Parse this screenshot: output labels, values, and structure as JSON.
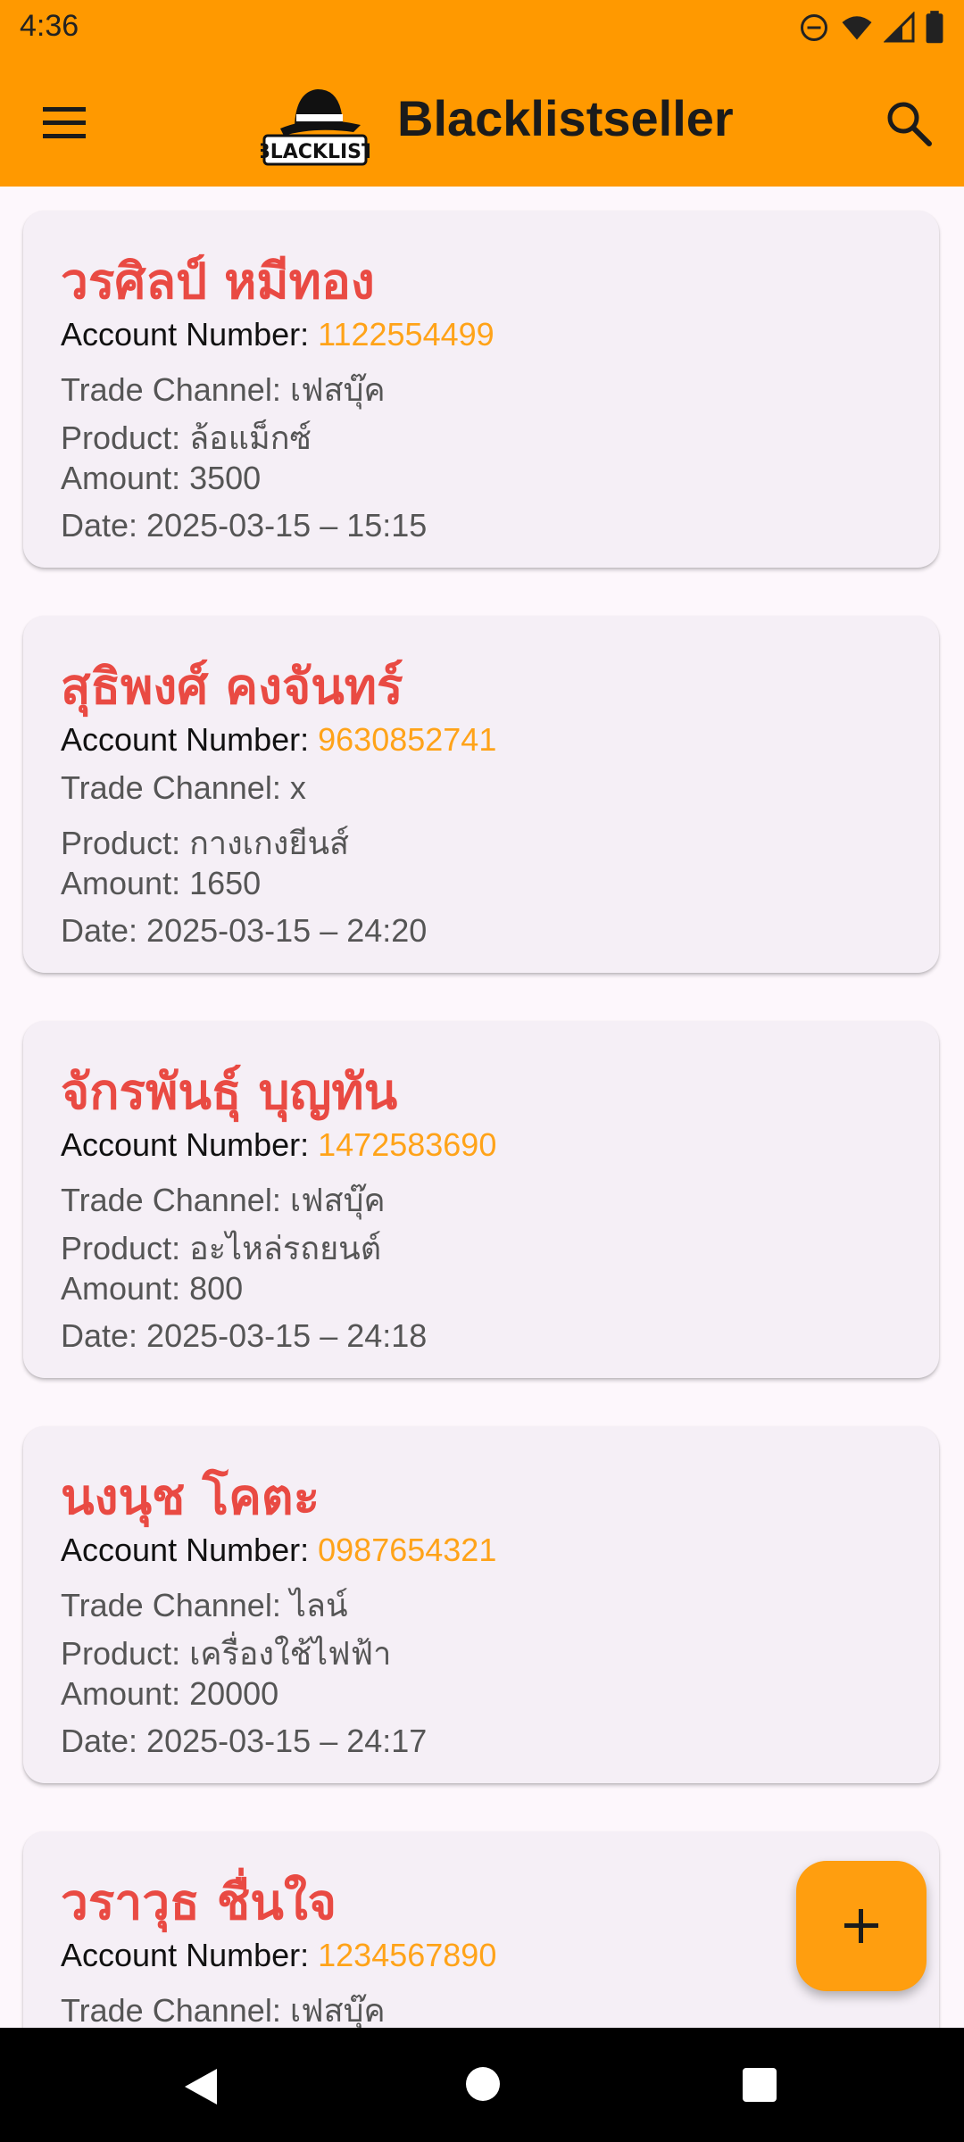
{
  "status_bar": {
    "time": "4:36",
    "icons": [
      "do-not-disturb-icon",
      "wifi-icon",
      "signal-icon",
      "battery-icon"
    ]
  },
  "app_bar": {
    "logo_text": "BLACKLIST",
    "title": "Blacklistseller",
    "menu_icon": "menu-icon",
    "search_icon": "search-icon",
    "color": "#ff9900"
  },
  "labels": {
    "account": "Account Number: ",
    "channel": "Trade Channel: ",
    "product": "Product: ",
    "amount": "Amount: ",
    "date": "Date: "
  },
  "records": [
    {
      "name": "วรศิลป์ หมีทอง",
      "account": "1122554499",
      "channel": "เฟสบุ๊ค",
      "product": "ล้อแม็กซ์",
      "amount": "3500",
      "date": "2025-03-15 – 15:15"
    },
    {
      "name": "สุธิพงศ์ คงจันทร์",
      "account": "9630852741",
      "channel": "x",
      "product": "กางเกงยีนส์",
      "amount": "1650",
      "date": "2025-03-15 – 24:20"
    },
    {
      "name": "จักรพันธุ์ บุญทัน",
      "account": "1472583690",
      "channel": "เฟสบุ๊ค",
      "product": "อะไหล่รถยนต์",
      "amount": "800",
      "date": "2025-03-15 – 24:18"
    },
    {
      "name": "นงนุช โคตะ",
      "account": "0987654321",
      "channel": "ไลน์",
      "product": "เครื่องใช้ไฟฟ้า",
      "amount": "20000",
      "date": "2025-03-15 – 24:17"
    },
    {
      "name": "วราวุธ ชื่นใจ",
      "account": "1234567890",
      "channel": "เฟสบุ๊ค",
      "product": "",
      "amount": "",
      "date": ""
    }
  ],
  "fab": {
    "icon": "plus-icon"
  },
  "colors": {
    "name": "#e94a43",
    "account_number": "#ffa319",
    "fab": "#ff9e0f"
  }
}
